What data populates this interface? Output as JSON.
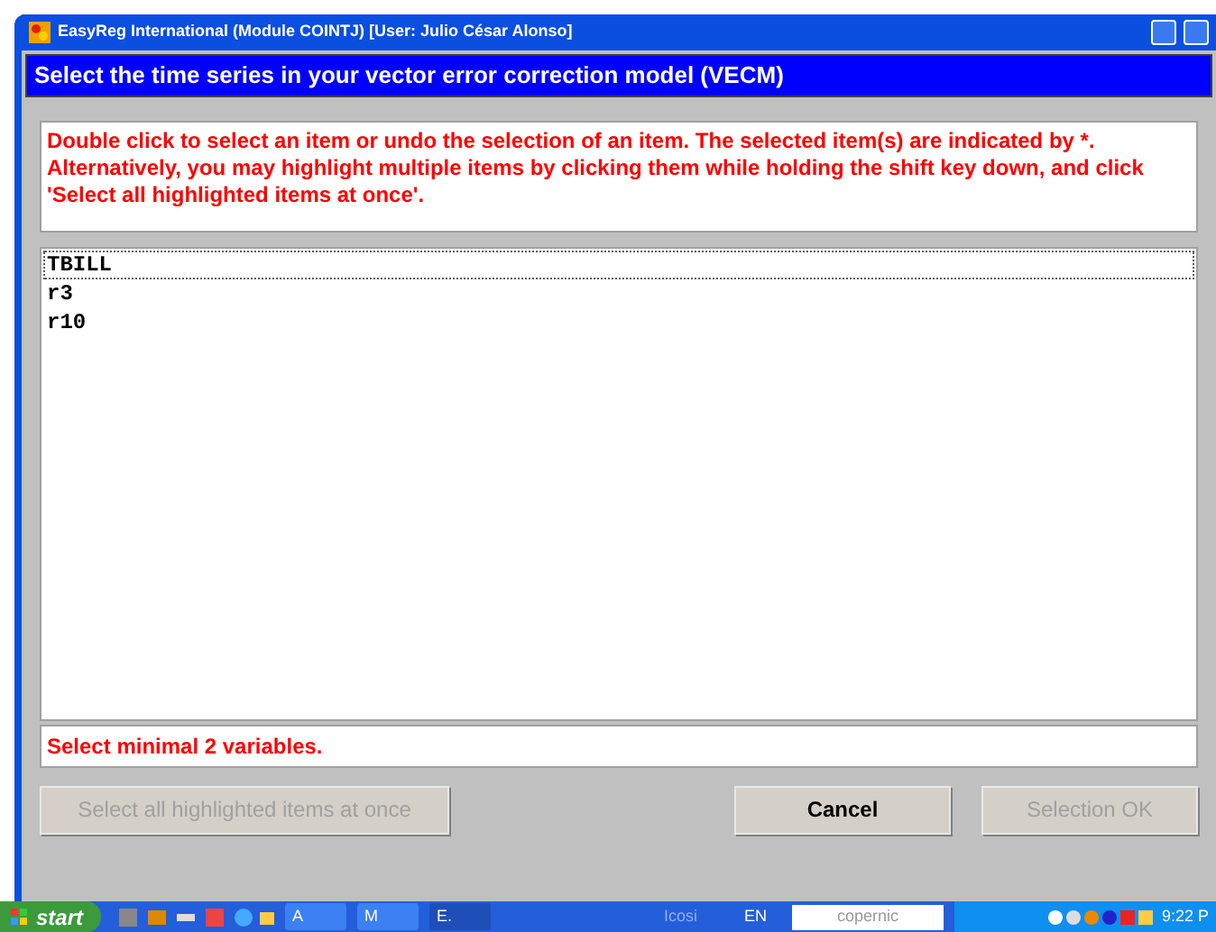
{
  "window": {
    "title": "EasyReg International (Module COINTJ) [User: Julio César Alonso]"
  },
  "header": "Select the time series in your vector error correction model (VECM)",
  "instructions": "Double click to select an item or undo the selection of an item. The selected item(s) are indicated by *. Alternatively, you may highlight multiple items by clicking them while holding the shift key down, and click 'Select all highlighted items at once'.",
  "items": [
    {
      "label": "TBILL",
      "focused": true
    },
    {
      "label": "r3",
      "focused": false
    },
    {
      "label": "r10",
      "focused": false
    }
  ],
  "status": "Select minimal 2 variables.",
  "buttons": [
    {
      "label": "Select all highlighted items at once",
      "disabled": true
    },
    {
      "label": "Cancel",
      "disabled": false
    },
    {
      "label": "Selection OK",
      "disabled": true
    }
  ],
  "taskbar": {
    "start": "start",
    "tasks": [
      {
        "label": "A",
        "selected": false
      },
      {
        "label": "M",
        "selected": false
      },
      {
        "label": "E.",
        "selected": true
      }
    ],
    "toolbar": "Icosi",
    "language": "EN",
    "search": "copernic",
    "clock": "9:22 P"
  }
}
